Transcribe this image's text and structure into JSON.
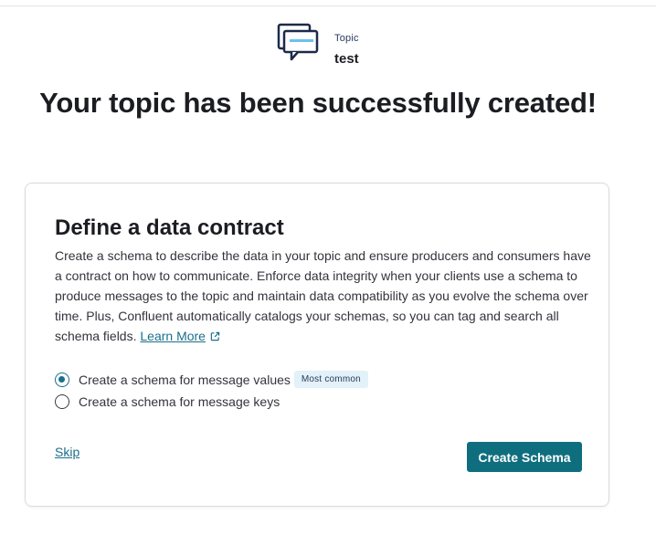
{
  "header": {
    "kicker": "Topic",
    "topic_name": "test",
    "icon": "chat-bubbles-icon"
  },
  "success_message": "Your topic has been successfully created!",
  "card": {
    "title": "Define a data contract",
    "description": "Create a schema to describe the data in your topic and ensure producers and consumers have a contract on how to communicate. Enforce data integrity when your clients use a schema to produce messages to the topic and maintain data compatibility as you evolve the schema over time. Plus, Confluent automatically catalogs your schemas, so you can tag and search all schema fields.",
    "learn_more_label": "Learn More",
    "options": [
      {
        "label": "Create a schema for message values",
        "badge": "Most common",
        "selected": true
      },
      {
        "label": "Create a schema for message keys",
        "badge": "",
        "selected": false
      }
    ],
    "skip_label": "Skip",
    "create_button_label": "Create Schema"
  },
  "colors": {
    "accent": "#1b6f8a",
    "button": "#0f6e7e",
    "badge_bg": "#e3f1f8",
    "text": "#1c1d23"
  }
}
